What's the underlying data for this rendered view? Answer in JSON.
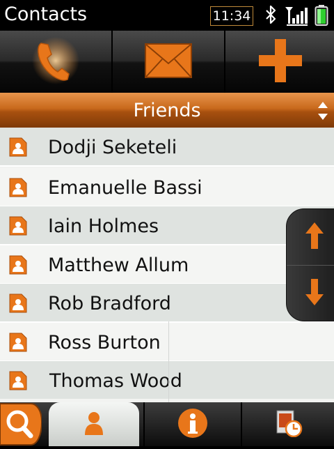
{
  "statusbar": {
    "title": "Contacts",
    "time": "11:34",
    "icons": [
      "bluetooth-icon",
      "signal-icon",
      "battery-icon"
    ]
  },
  "actions": [
    {
      "name": "call",
      "icon": "phone-icon"
    },
    {
      "name": "message",
      "icon": "envelope-icon"
    },
    {
      "name": "add",
      "icon": "plus-icon"
    }
  ],
  "group": {
    "label": "Friends",
    "sort_icon": "sort-arrows-icon"
  },
  "contacts": [
    "Dodji Seketeli",
    "Emanuelle Bassi",
    "Iain Holmes",
    "Matthew Allum",
    "Rob Bradford",
    "Ross Burton",
    "Thomas Wood"
  ],
  "scroller": {
    "up_icon": "arrow-up-icon",
    "down_icon": "arrow-down-icon"
  },
  "toolbar": [
    {
      "name": "search",
      "icon": "search-icon"
    },
    {
      "name": "contacts",
      "icon": "person-icon",
      "active": true
    },
    {
      "name": "info",
      "icon": "info-icon"
    },
    {
      "name": "history",
      "icon": "history-icon"
    }
  ],
  "colors": {
    "accent": "#e8761a",
    "accent_dark": "#a84e0c",
    "row_odd": "#dfe3e0",
    "row_even": "#f4f5f3"
  }
}
